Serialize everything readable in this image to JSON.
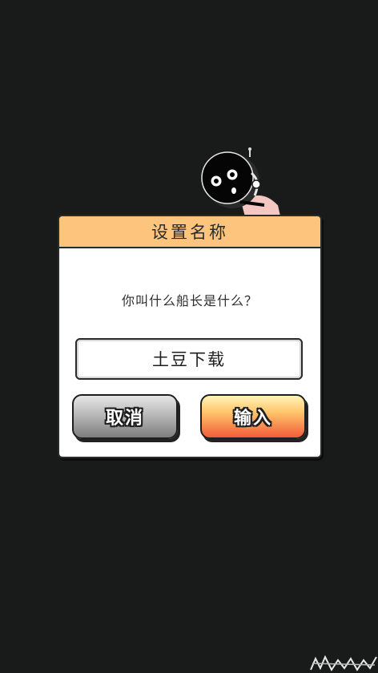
{
  "dialog": {
    "title": "设置名称",
    "prompt": "你叫什么船长是什么？",
    "name_value": "土豆下载",
    "cancel_label": "取消",
    "confirm_label": "输入"
  },
  "colors": {
    "background": "#181b19",
    "header": "#fcc47c",
    "confirm_gradient_top": "#fff4b8",
    "confirm_gradient_bottom": "#f25b3a",
    "cancel_gradient_top": "#e6e6e6",
    "cancel_gradient_bottom": "#7d7d7d"
  },
  "icons": {
    "mascot": "round-black-ninja-mascot-icon",
    "corner": "decorative-scribble-icon"
  }
}
